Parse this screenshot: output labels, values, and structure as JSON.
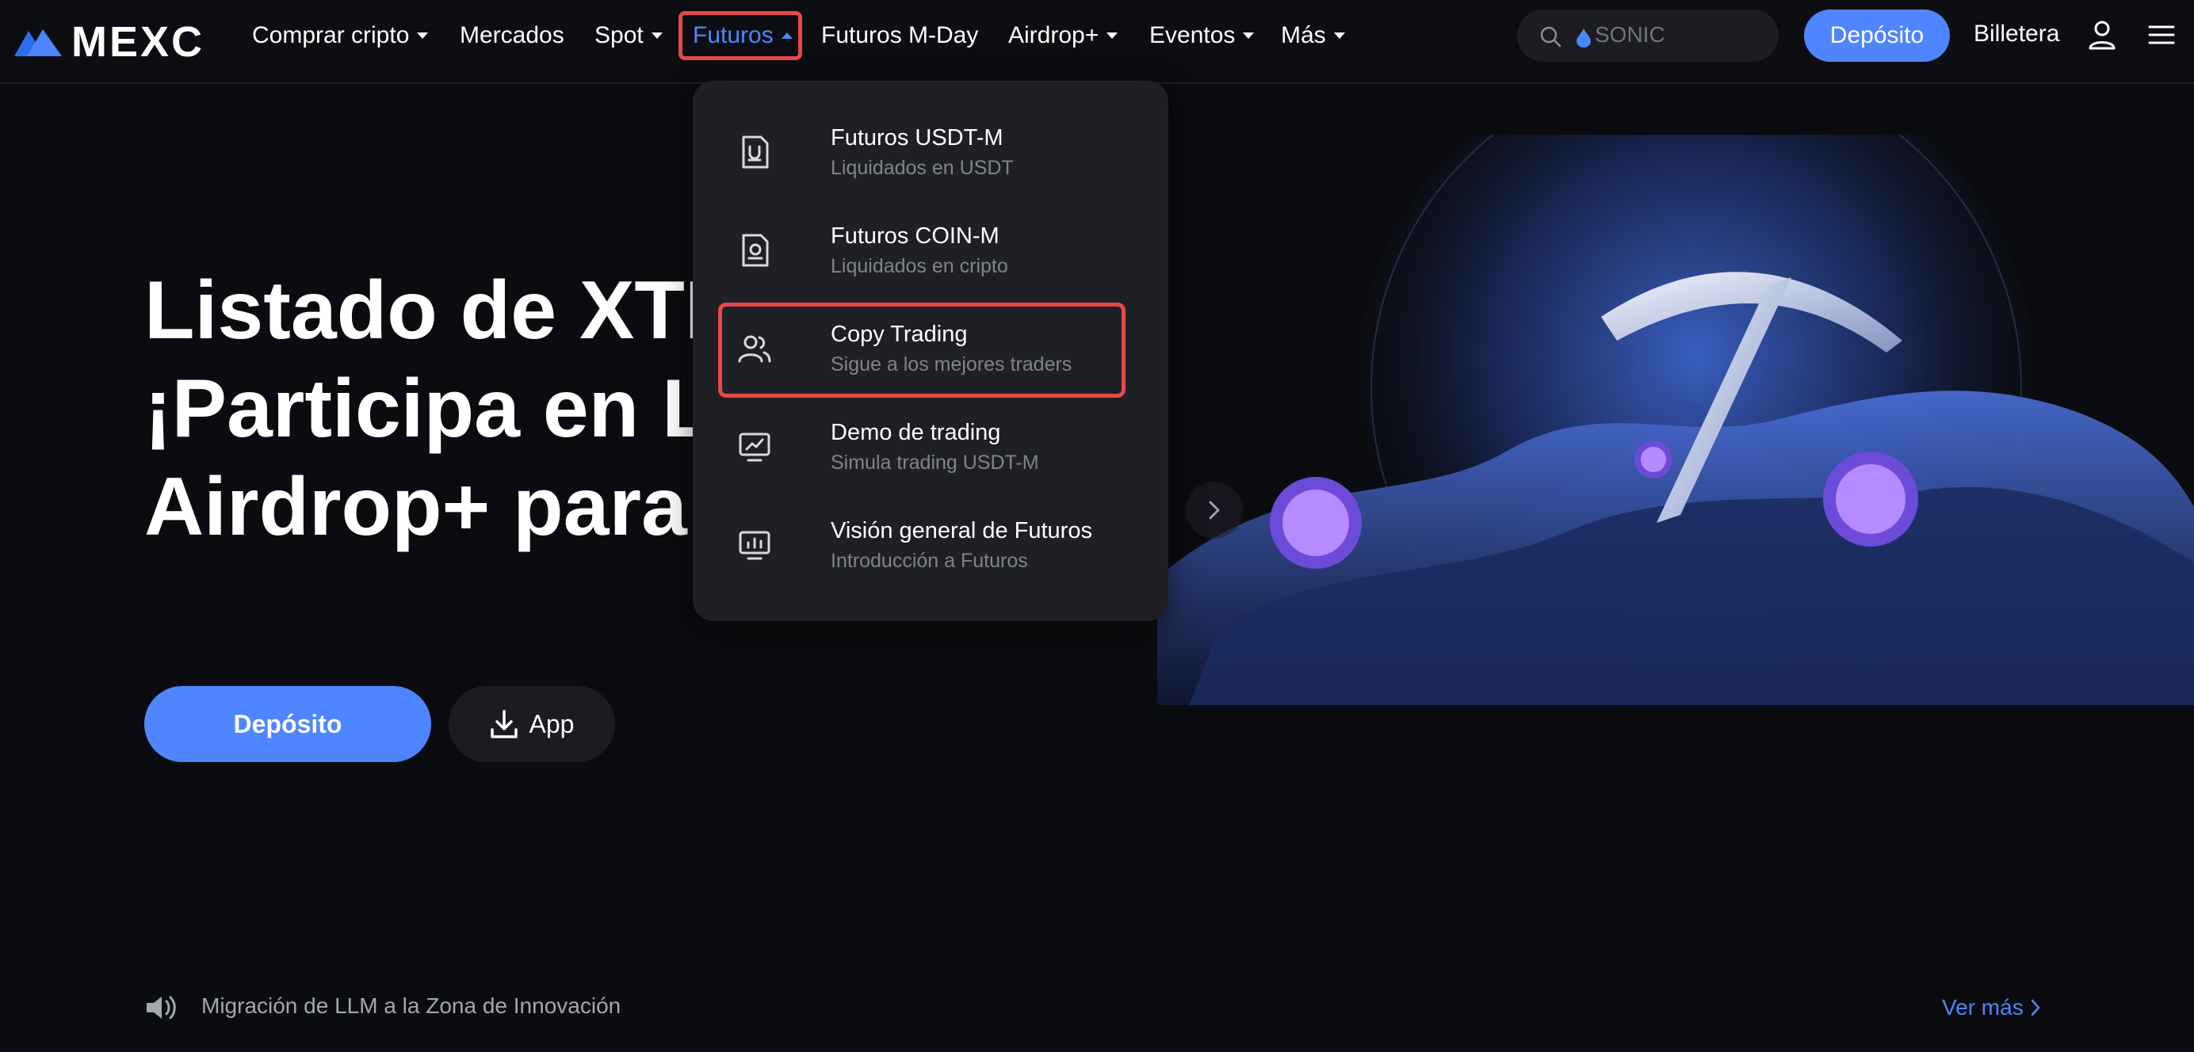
{
  "brand": {
    "name": "MEXC"
  },
  "nav": {
    "items": [
      {
        "label": "Comprar cripto",
        "has_caret": true
      },
      {
        "label": "Mercados",
        "has_caret": false
      },
      {
        "label": "Spot",
        "has_caret": true
      },
      {
        "label": "Futuros",
        "has_caret": true,
        "active": true
      },
      {
        "label": "Futuros M-Day",
        "has_caret": false
      },
      {
        "label": "Airdrop+",
        "has_caret": true
      },
      {
        "label": "Eventos",
        "has_caret": true
      },
      {
        "label": "Más",
        "has_caret": true
      }
    ],
    "search_placeholder": "SONIC",
    "deposit_label": "Depósito",
    "wallet_label": "Billetera"
  },
  "futures_menu": {
    "items": [
      {
        "title": "Futuros USDT-M",
        "subtitle": "Liquidados en USDT",
        "icon": "usdt-doc-icon"
      },
      {
        "title": "Futuros COIN-M",
        "subtitle": "Liquidados en cripto",
        "icon": "coin-doc-icon"
      },
      {
        "title": "Copy Trading",
        "subtitle": "Sigue a los mejores traders",
        "icon": "users-icon",
        "highlighted": true
      },
      {
        "title": "Demo de trading",
        "subtitle": "Simula trading USDT-M",
        "icon": "chart-monitor-icon"
      },
      {
        "title": "Visión general de Futuros",
        "subtitle": "Introducción a Futuros",
        "icon": "bar-monitor-icon"
      }
    ]
  },
  "hero": {
    "title_lines": [
      "Listado de XTER",
      "¡Participa en Lau",
      "Airdrop+ para ga"
    ],
    "deposit_label": "Depósito",
    "app_label": "App"
  },
  "announcement": {
    "text": "Migración de LLM a la Zona de Innovación",
    "more_label": "Ver más"
  },
  "colors": {
    "background": "#0b0c0f",
    "accent": "#4f86ff",
    "highlight_border": "#e8484a",
    "dropdown_bg": "#1f2025"
  }
}
